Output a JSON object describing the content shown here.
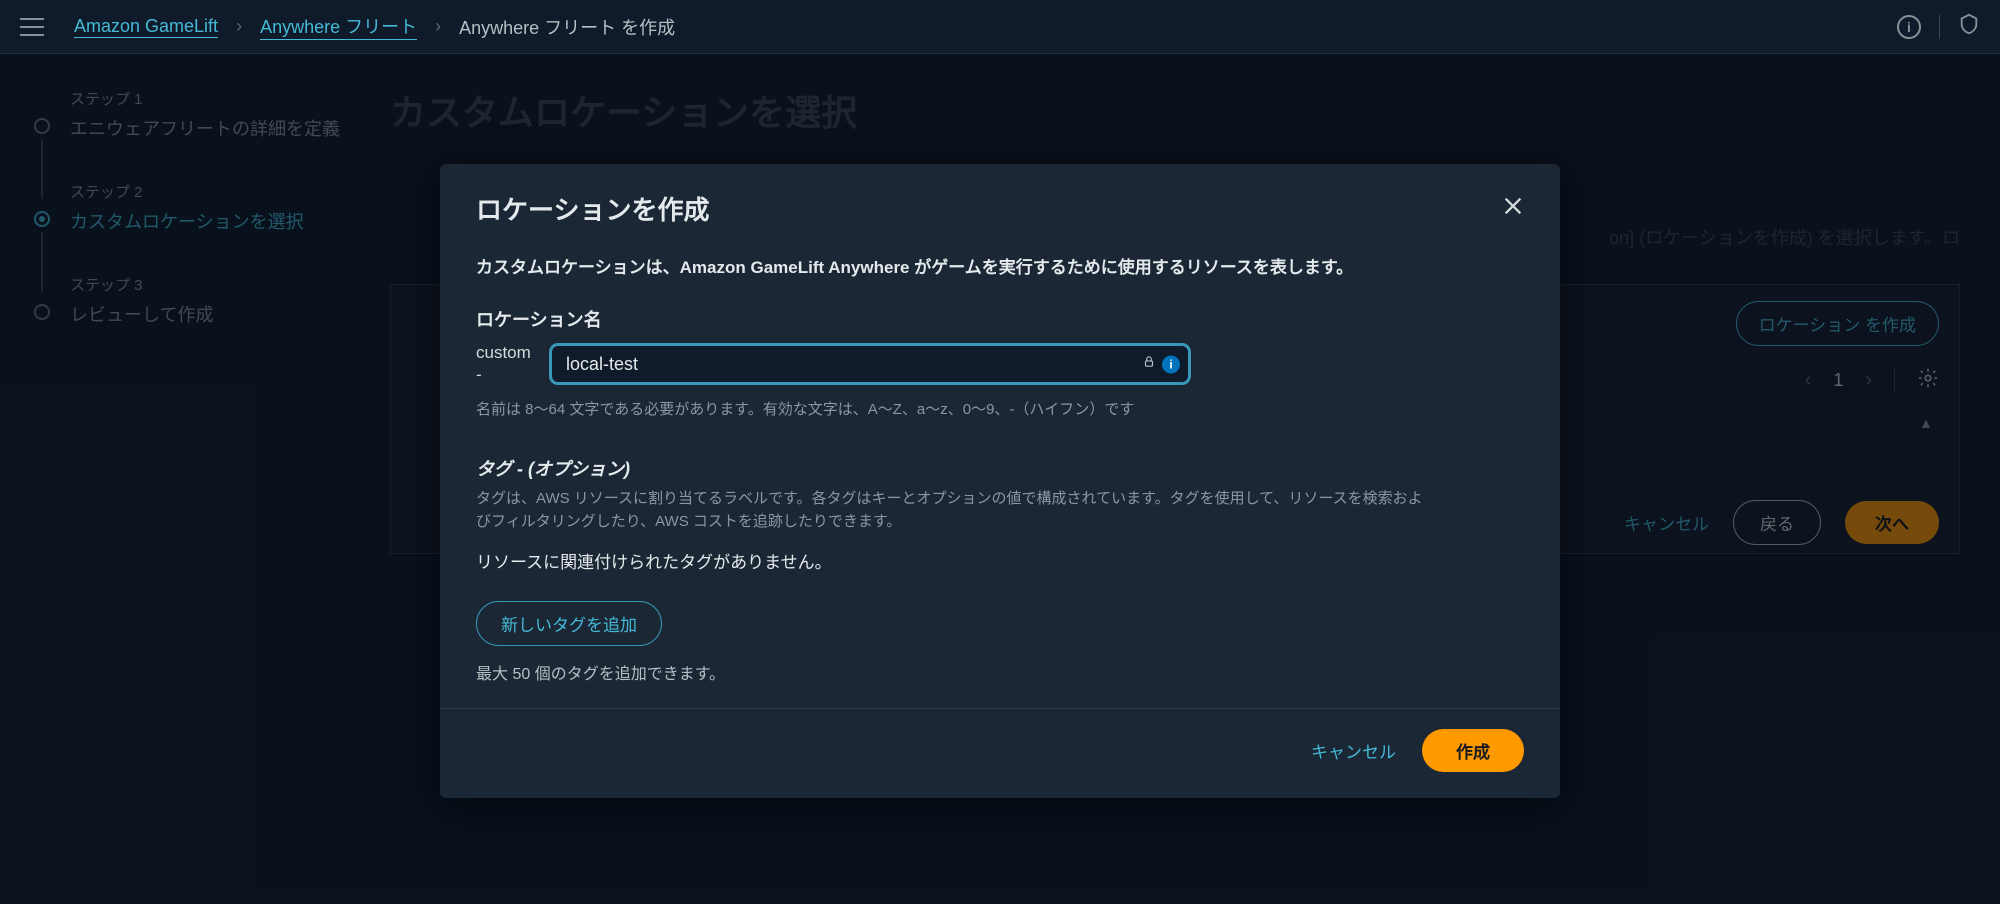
{
  "breadcrumb": {
    "root": "Amazon GameLift",
    "mid": "Anywhere フリート",
    "current": "Anywhere フリート を作成"
  },
  "steps": [
    {
      "label": "ステップ 1",
      "title": "エニウェアフリートの詳細を定義"
    },
    {
      "label": "ステップ 2",
      "title": "カスタムロケーションを選択"
    },
    {
      "label": "ステップ 3",
      "title": "レビューして作成"
    }
  ],
  "steps_active_index": 1,
  "background": {
    "heading_fragment": "カスタムロケーションを選択",
    "desc_fragment": "on] (ロケーションを作成) を選択します。ロ",
    "create_location_btn": "ロケーション を作成",
    "page_num": "1",
    "cancel": "キャンセル",
    "back": "戻る",
    "next": "次へ"
  },
  "modal": {
    "title": "ロケーションを作成",
    "subtitle": "カスタムロケーションは、Amazon GameLift Anywhere がゲームを実行するために使用するリソースを表します。",
    "location_label": "ロケーション名",
    "prefix_top": "custom",
    "prefix_bot": "-",
    "input_value": "local-test",
    "name_hint": "名前は 8〜64 文字である必要があります。有効な文字は、A〜Z、a〜z、0〜9、-（ハイフン）です",
    "tags_title": "タグ - (オプション)",
    "tags_desc": "タグは、AWS リソースに割り当てるラベルです。各タグはキーとオプションの値で構成されています。タグを使用して、リソースを検索およびフィルタリングしたり、AWS コストを追跡したりできます。",
    "no_tags": "リソースに関連付けられたタグがありません。",
    "add_tag": "新しいタグを追加",
    "max_tag": "最大 50 個のタグを追加できます。",
    "cancel": "キャンセル",
    "create": "作成"
  }
}
